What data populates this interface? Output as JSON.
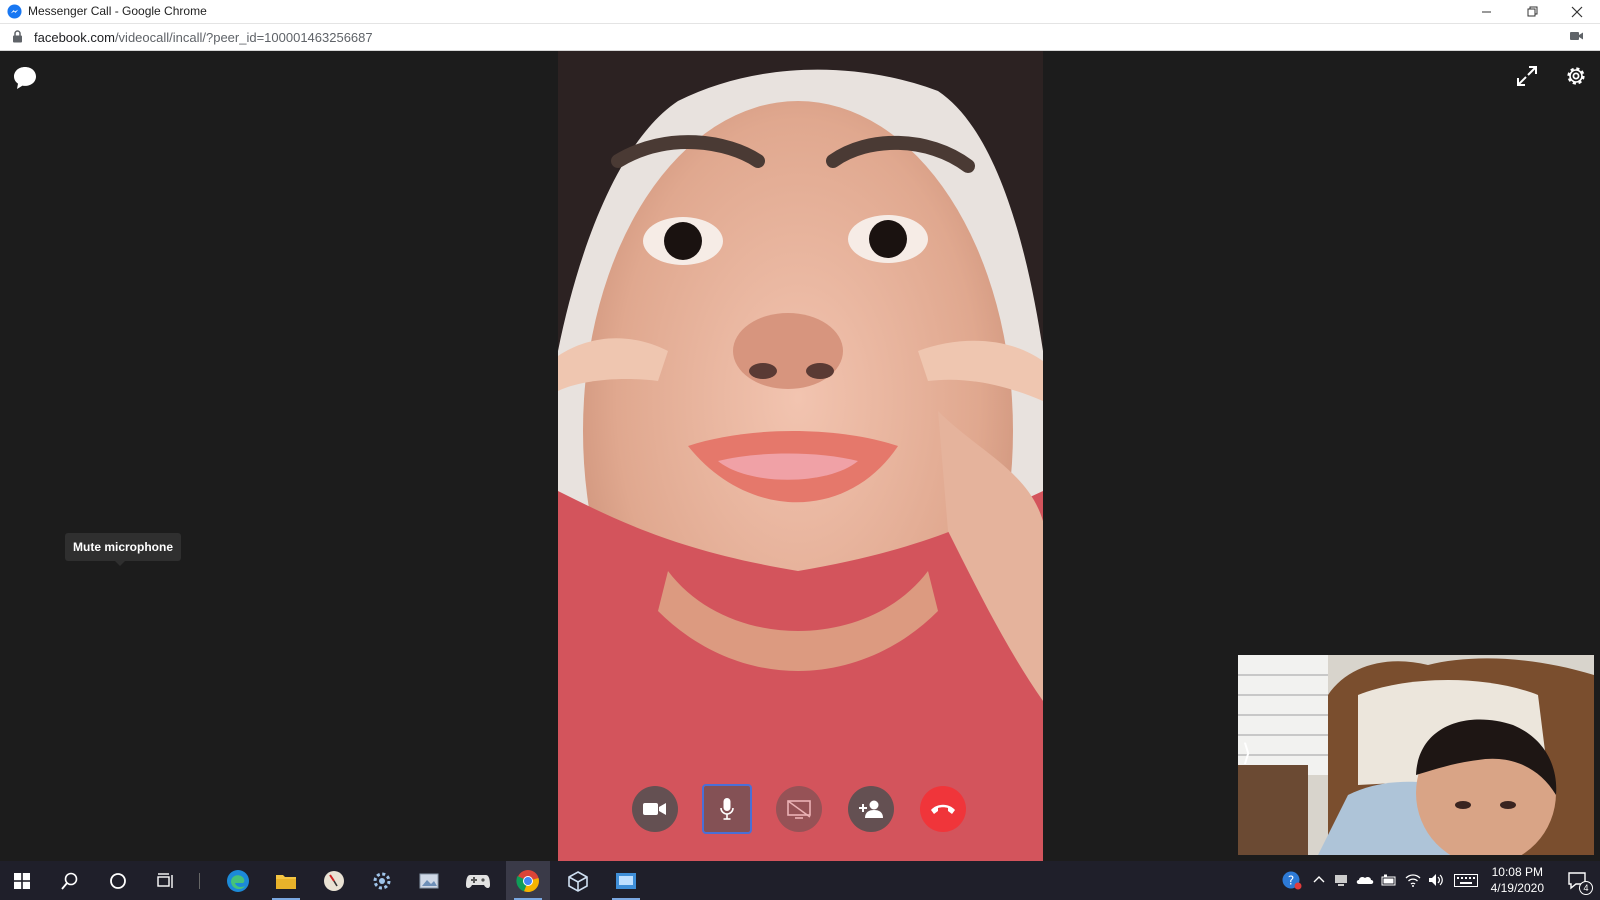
{
  "window": {
    "title": "Messenger Call - Google Chrome",
    "controls": [
      "minimize",
      "restore",
      "close"
    ]
  },
  "addressbar": {
    "domain": "facebook.com",
    "path": "/videocall/incall/?peer_id=100001463256687"
  },
  "call": {
    "tooltip": "Mute microphone",
    "controls": [
      {
        "icon": "video-camera-icon"
      },
      {
        "icon": "microphone-icon"
      },
      {
        "icon": "screen-share-icon"
      },
      {
        "icon": "add-person-icon"
      },
      {
        "icon": "end-call-icon"
      }
    ],
    "pip_toggle": "⟩"
  },
  "taskbar": {
    "apps": [
      "start-icon",
      "search-icon",
      "cortana-icon",
      "task-view-icon",
      "edge-icon",
      "file-explorer-icon",
      "clock-app-icon",
      "settings-icon",
      "photos-icon",
      "game-controller-icon",
      "chrome-icon",
      "3d-viewer-icon",
      "remote-desktop-icon"
    ],
    "time": "10:08 PM",
    "date": "4/19/2020",
    "notification_count": "4"
  },
  "colors": {
    "end_call": "#f0353a",
    "stage_bg": "#1c1c1c",
    "focus_outline": "#4a6fd6"
  }
}
